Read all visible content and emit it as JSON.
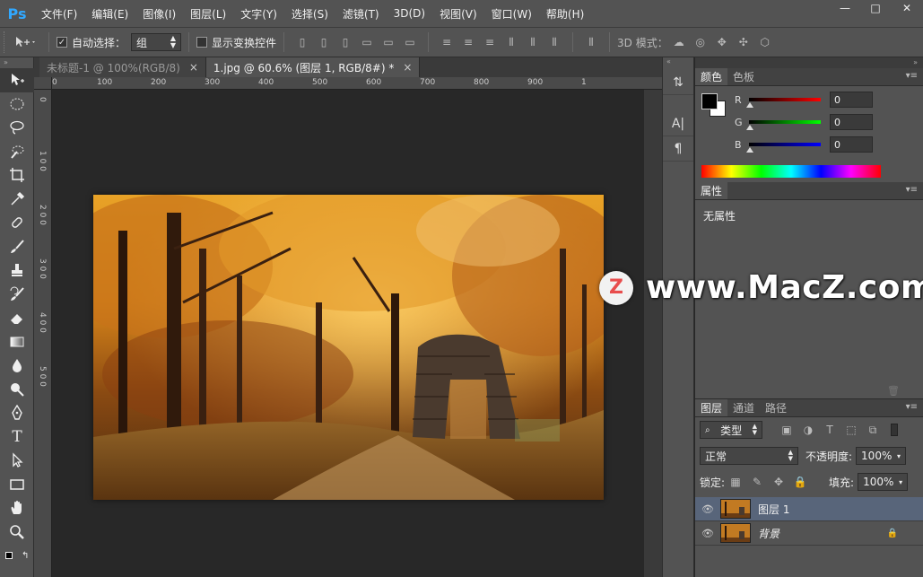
{
  "app": {
    "logo": "Ps"
  },
  "menu": [
    "文件(F)",
    "编辑(E)",
    "图像(I)",
    "图层(L)",
    "文字(Y)",
    "选择(S)",
    "滤镜(T)",
    "3D(D)",
    "视图(V)",
    "窗口(W)",
    "帮助(H)"
  ],
  "window_buttons": {
    "minimize": "—",
    "maximize": "□",
    "close": "✕"
  },
  "options_bar": {
    "auto_select_label": "自动选择：",
    "auto_select_checked": true,
    "auto_select_value": "组",
    "show_transform_label": "显示变换控件",
    "show_transform_checked": false,
    "mode_3d_label": "3D 模式："
  },
  "tabs": [
    {
      "label": "未标题-1 @ 100%(RGB/8)",
      "close": "×",
      "active": false
    },
    {
      "label": "1.jpg @ 60.6% (图层 1, RGB/8#) *",
      "close": "×",
      "active": true
    }
  ],
  "ruler": {
    "h_ticks": [
      "0",
      "100",
      "200",
      "300",
      "400",
      "500",
      "600",
      "700",
      "800",
      "900",
      "1"
    ],
    "v_ticks": [
      "0",
      "1 0 0",
      "2 0 0",
      "3 0 0",
      "4 0 0",
      "5 0 0"
    ]
  },
  "color_panel": {
    "tabs": [
      "颜色",
      "色板"
    ],
    "channels": [
      {
        "label": "R",
        "value": "0",
        "color": "#ff0000"
      },
      {
        "label": "G",
        "value": "0",
        "color": "#00ff00"
      },
      {
        "label": "B",
        "value": "0",
        "color": "#0000ff"
      }
    ],
    "foreground": "#000000",
    "background": "#ffffff"
  },
  "properties_panel": {
    "tab": "属性",
    "empty_text": "无属性"
  },
  "layers_panel": {
    "tabs": [
      "图层",
      "通道",
      "路径"
    ],
    "filter_kind": "类型",
    "blend_mode": "正常",
    "opacity_label": "不透明度:",
    "opacity_value": "100%",
    "lock_label": "锁定:",
    "fill_label": "填充:",
    "fill_value": "100%",
    "layers": [
      {
        "name": "图层 1",
        "active": true,
        "locked": false
      },
      {
        "name": "背景",
        "active": false,
        "locked": true
      }
    ]
  },
  "watermark": {
    "logo_letter": "Z",
    "text": "www.MacZ.com"
  }
}
